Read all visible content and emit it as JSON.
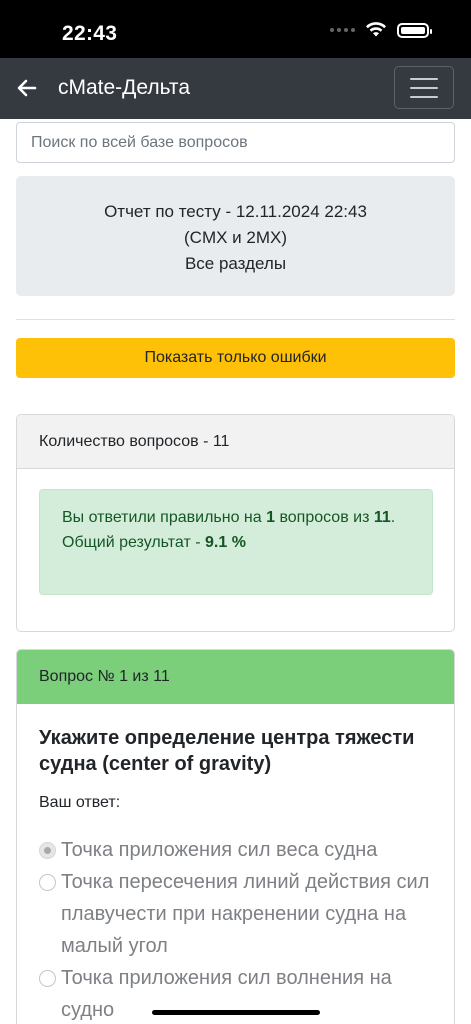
{
  "status_bar": {
    "time": "22:43"
  },
  "navbar": {
    "title": "cMate-Дельта"
  },
  "search": {
    "placeholder": "Поиск по всей базе вопросов"
  },
  "report": {
    "line1": "Отчет по тесту - 12.11.2024 22:43",
    "line2": "(CMX и 2MX)",
    "line3": "Все разделы"
  },
  "errors_button": {
    "label": "Показать только ошибки"
  },
  "summary": {
    "header": "Количество вопросов - 11",
    "text_prefix": "Вы ответили правильно на ",
    "correct": "1",
    "text_middle": " вопросов из ",
    "total": "11",
    "text_suffix": ".",
    "result_label": "Общий результат - ",
    "result_value": "9.1 %"
  },
  "question": {
    "header": "Вопрос № 1 из 11",
    "text": "Укажите определение центра тяжести судна (center of gravity)",
    "answer_label": "Ваш ответ:",
    "options": [
      {
        "label": "Точка приложения сил веса судна",
        "checked": true
      },
      {
        "label": "Точка пересечения линий действия сил плавучести при накренении судна на малый угол",
        "checked": false
      },
      {
        "label": "Точка приложения сил волнения на судно",
        "checked": false
      }
    ]
  },
  "colors": {
    "navbar": "#343a40",
    "warning": "#ffc107",
    "success_bg": "#d4edda",
    "success_text": "#155724",
    "question_header": "#7bcf7b"
  },
  "icons": [
    "back-arrow-icon",
    "menu-icon",
    "wifi-icon",
    "battery-icon",
    "signal-icon"
  ]
}
